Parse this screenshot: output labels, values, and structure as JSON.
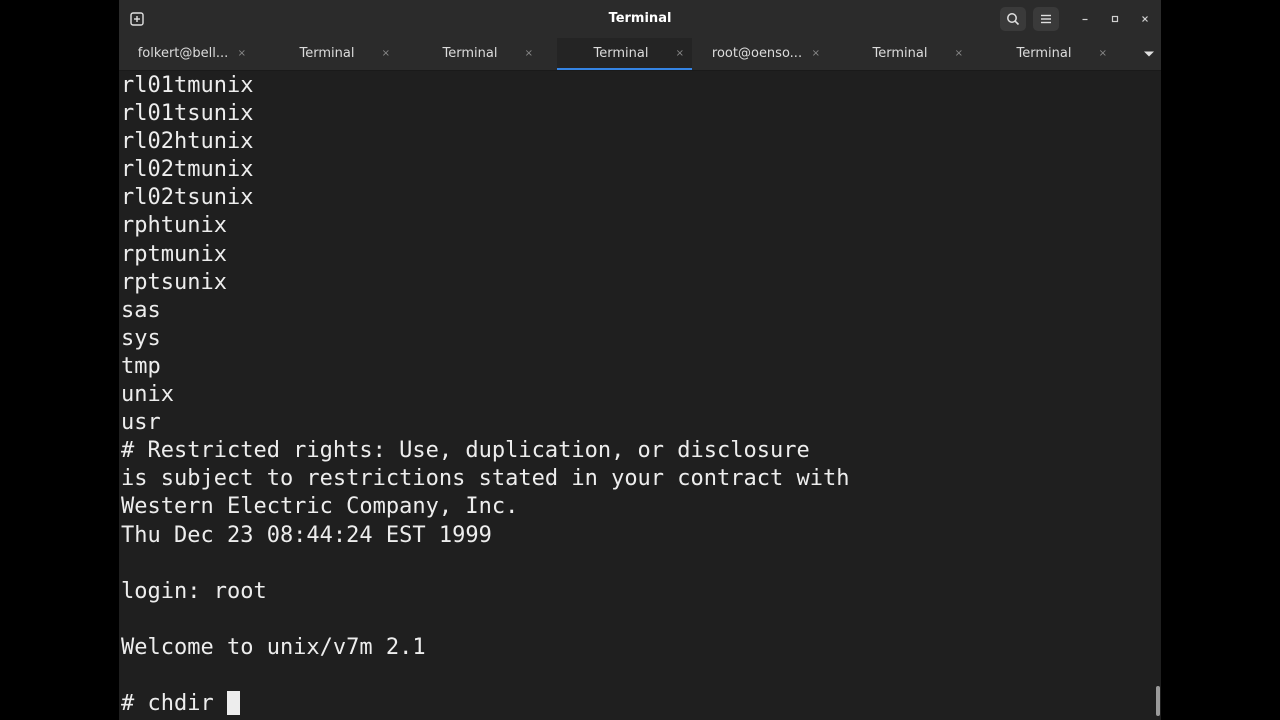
{
  "window": {
    "title": "Terminal"
  },
  "tabs": [
    {
      "label": "folkert@bell...",
      "close": "×",
      "active": false
    },
    {
      "label": "Terminal",
      "close": "×",
      "active": false
    },
    {
      "label": "Terminal",
      "close": "×",
      "active": false
    },
    {
      "label": "Terminal",
      "close": "×",
      "active": true
    },
    {
      "label": "root@oenso...",
      "close": "×",
      "active": false
    },
    {
      "label": "Terminal",
      "close": "×",
      "active": false
    },
    {
      "label": "Terminal",
      "close": "×",
      "active": false
    }
  ],
  "terminal": {
    "lines": [
      "rl01tmunix",
      "rl01tsunix",
      "rl02htunix",
      "rl02tmunix",
      "rl02tsunix",
      "rphtunix",
      "rptmunix",
      "rptsunix",
      "sas",
      "sys",
      "tmp",
      "unix",
      "usr",
      "# Restricted rights: Use, duplication, or disclosure",
      "is subject to restrictions stated in your contract with",
      "Western Electric Company, Inc.",
      "Thu Dec 23 08:44:24 EST 1999",
      "",
      "login: root",
      "",
      "Welcome to unix/v7m 2.1",
      "",
      "# chdir"
    ]
  },
  "icons": {
    "new_tab": "new-tab-icon",
    "search": "search-icon",
    "menu": "hamburger-menu-icon",
    "minimize": "minimize-icon",
    "maximize": "maximize-icon",
    "close": "close-icon",
    "tab_overflow": "chevron-down-icon"
  },
  "colors": {
    "terminal_bg": "#1f1f1f",
    "terminal_fg": "#ededed",
    "titlebar_bg": "#2b2b2b",
    "active_tab_accent": "#3584e4"
  }
}
